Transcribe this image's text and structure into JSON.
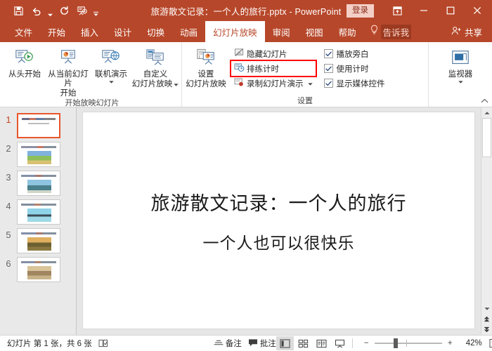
{
  "window": {
    "title": "旅游散文记录：一个人的旅行.pptx  -  PowerPoint",
    "signin_label": "登录",
    "quick_access": [
      {
        "name": "save-icon",
        "label": "保存"
      },
      {
        "name": "undo-icon",
        "label": "撤销"
      },
      {
        "name": "redo-icon",
        "label": "恢复"
      },
      {
        "name": "start-slideshow-icon",
        "label": "从头开始"
      },
      {
        "name": "customize-qat-icon",
        "label": "自定义快速访问工具栏"
      }
    ],
    "controls": [
      {
        "name": "ribbon-display-options-button",
        "label": "功能区显示选项"
      },
      {
        "name": "minimize-button",
        "label": "最小化"
      },
      {
        "name": "maximize-button",
        "label": "最大化"
      },
      {
        "name": "close-button",
        "label": "关闭"
      }
    ],
    "accent_color": "#b7472a"
  },
  "tabs": [
    {
      "label": "文件",
      "active": false
    },
    {
      "label": "开始",
      "active": false
    },
    {
      "label": "插入",
      "active": false
    },
    {
      "label": "设计",
      "active": false
    },
    {
      "label": "切换",
      "active": false
    },
    {
      "label": "动画",
      "active": false
    },
    {
      "label": "幻灯片放映",
      "active": true
    },
    {
      "label": "审阅",
      "active": false
    },
    {
      "label": "视图",
      "active": false
    },
    {
      "label": "帮助",
      "active": false
    }
  ],
  "tell_me": {
    "label": "告诉我",
    "icon": "lightbulb-icon"
  },
  "share": {
    "label": "共享",
    "icon": "share-person-icon"
  },
  "ribbon": {
    "groups": [
      {
        "name": "start-slideshow-group",
        "label": "开始放映幻灯片",
        "buttons": [
          {
            "name": "from-beginning-button",
            "label_line1": "从头开始",
            "label_line2": "",
            "dropdown": false
          },
          {
            "name": "from-current-slide-button",
            "label_line1": "从当前幻灯片",
            "label_line2": "开始",
            "dropdown": false
          },
          {
            "name": "present-online-button",
            "label_line1": "联机演示",
            "label_line2": "",
            "dropdown": true
          },
          {
            "name": "custom-slide-show-button",
            "label_line1": "自定义",
            "label_line2": "幻灯片放映",
            "dropdown": true
          }
        ]
      },
      {
        "name": "setup-group",
        "label": "设置",
        "big_button": {
          "name": "set-up-slide-show-button",
          "label_line1": "设置",
          "label_line2": "幻灯片放映"
        },
        "small_buttons": [
          {
            "name": "hide-slide-button",
            "label": "隐藏幻灯片",
            "highlighted": false,
            "dropdown": false
          },
          {
            "name": "rehearse-timings-button",
            "label": "排练计时",
            "highlighted": true,
            "dropdown": false
          },
          {
            "name": "record-slide-show-button",
            "label": "录制幻灯片演示",
            "highlighted": false,
            "dropdown": true
          }
        ],
        "checkboxes": [
          {
            "name": "play-narrations-checkbox",
            "label": "播放旁白",
            "checked": true
          },
          {
            "name": "use-timings-checkbox",
            "label": "使用计时",
            "checked": true
          },
          {
            "name": "show-media-controls-checkbox",
            "label": "显示媒体控件",
            "checked": true
          }
        ]
      },
      {
        "name": "monitors-group",
        "label": "",
        "big_button": {
          "name": "monitor-button",
          "label_line1": "监视器",
          "label_line2": "",
          "dropdown": true
        }
      }
    ],
    "collapse_icon": "chevron-up-icon",
    "highlight_color": "#ff0000"
  },
  "thumbnails": {
    "selected_index": 1,
    "selection_color": "#e8562a",
    "items": [
      {
        "number": "1",
        "type": "title",
        "photo_colors": []
      },
      {
        "number": "2",
        "type": "photo",
        "photo_colors": [
          "#7fb2dd",
          "#8fbf5a",
          "#d8c272"
        ]
      },
      {
        "number": "3",
        "type": "photo",
        "photo_colors": [
          "#8fc4e0",
          "#4a7f8c",
          "#cfd6c8"
        ]
      },
      {
        "number": "4",
        "type": "photo",
        "photo_colors": [
          "#8fd3e8",
          "#3a4a55",
          "#9fd8e6"
        ]
      },
      {
        "number": "5",
        "type": "photo",
        "photo_colors": [
          "#e0b060",
          "#6b6030",
          "#8a7840"
        ]
      },
      {
        "number": "6",
        "type": "photo",
        "photo_colors": [
          "#d9c49a",
          "#a08560",
          "#c9b489"
        ]
      }
    ]
  },
  "slide": {
    "title": "旅游散文记录：一个人的旅行",
    "subtitle": "一个人也可以很快乐"
  },
  "status": {
    "slide_counter": "幻灯片 第 1 张，共 6 张",
    "spellcheck_icon": "spellcheck-icon",
    "notes": {
      "label": "备注",
      "icon": "notes-icon"
    },
    "comments": {
      "label": "批注",
      "icon": "comment-icon"
    },
    "views": [
      {
        "name": "normal-view-button",
        "icon": "normal-view-icon",
        "active": true
      },
      {
        "name": "slide-sorter-view-button",
        "icon": "slide-sorter-icon",
        "active": false
      },
      {
        "name": "reading-view-button",
        "icon": "reading-view-icon",
        "active": false
      },
      {
        "name": "slideshow-view-button",
        "icon": "slideshow-icon",
        "active": false
      }
    ],
    "zoom": {
      "minus": "−",
      "plus": "+",
      "percent": "42%",
      "value": 42
    },
    "fit_window": {
      "name": "fit-slide-button",
      "icon": "fit-to-window-icon"
    }
  },
  "scrollbar": {
    "up_icon": "scroll-up-icon",
    "down_icon": "scroll-down-icon",
    "prev_slide_icon": "previous-slide-icon",
    "next_slide_icon": "next-slide-icon"
  }
}
